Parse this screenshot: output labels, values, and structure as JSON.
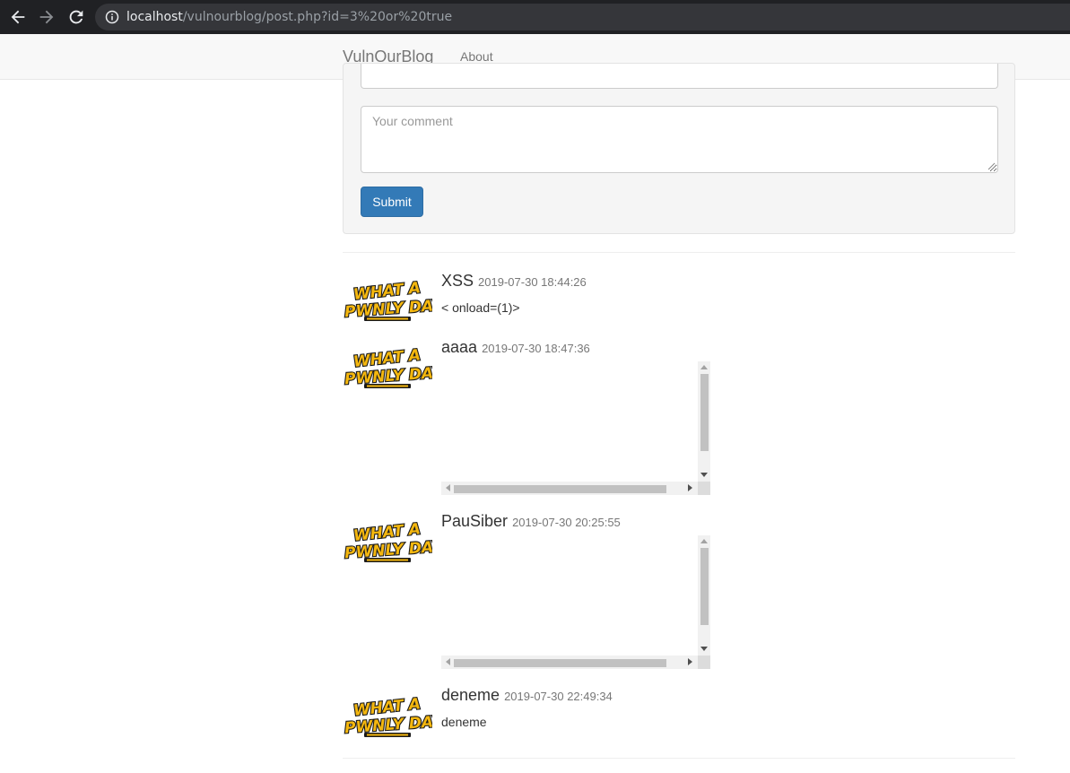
{
  "browser": {
    "url_host": "localhost",
    "url_path": "/vulnourblog/post.php?id=3%20or%20true"
  },
  "navbar": {
    "brand": "VulnOurBlog",
    "links": [
      "About"
    ]
  },
  "comment_form": {
    "comment_placeholder": "Your comment",
    "submit_label": "Submit"
  },
  "avatar_alt": "WHAT A PWNLY DAY",
  "comments": [
    {
      "author": "XSS",
      "date": "2019-07-30 18:44:26",
      "text": "< onload=(1)>"
    },
    {
      "author": "aaaa",
      "date": "2019-07-30 18:47:36",
      "text": ""
    },
    {
      "author": "PauSiber",
      "date": "2019-07-30 20:25:55",
      "text": ""
    },
    {
      "author": "deneme",
      "date": "2019-07-30 22:49:34",
      "text": "deneme"
    }
  ],
  "colors": {
    "primary": "#337ab7",
    "logo_yellow": "#f4b70f",
    "chrome_bg": "#202124"
  }
}
